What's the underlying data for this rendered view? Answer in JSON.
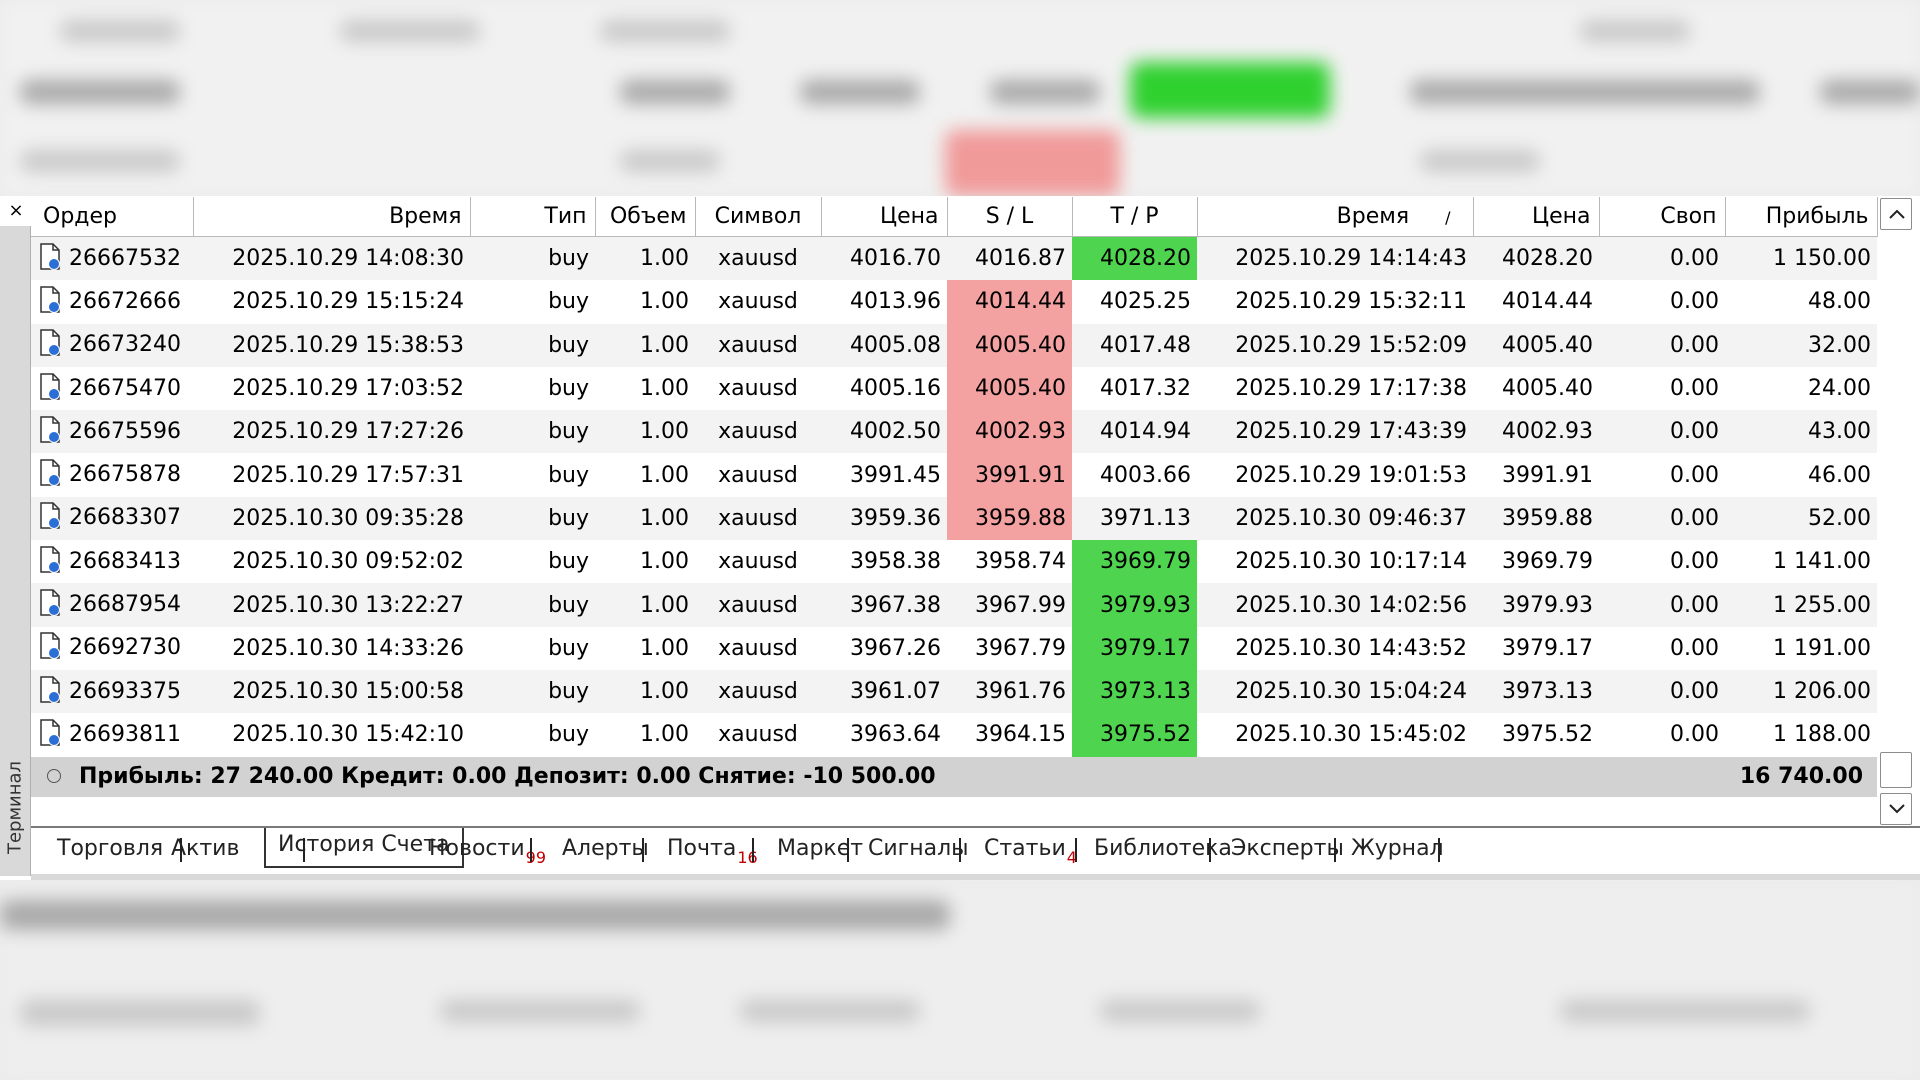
{
  "terminal": {
    "side_label": "Терминал",
    "close_glyph": "×"
  },
  "columns": [
    "Ордер",
    "Время",
    "Тип",
    "Объем",
    "Символ",
    "Цена",
    "S / L",
    "T / P",
    "Время",
    "Цена",
    "Своп",
    "Прибыль"
  ],
  "sort_indicator": "/",
  "rows": [
    {
      "order": "26667532",
      "open_time": "2025.10.29 14:08:30",
      "type": "buy",
      "volume": "1.00",
      "symbol": "xauusd",
      "open_price": "4016.70",
      "sl": "4016.87",
      "tp": "4028.20",
      "close_time": "2025.10.29 14:14:43",
      "close_price": "4028.20",
      "swap": "0.00",
      "profit": "1 150.00",
      "hit": "tp"
    },
    {
      "order": "26672666",
      "open_time": "2025.10.29 15:15:24",
      "type": "buy",
      "volume": "1.00",
      "symbol": "xauusd",
      "open_price": "4013.96",
      "sl": "4014.44",
      "tp": "4025.25",
      "close_time": "2025.10.29 15:32:11",
      "close_price": "4014.44",
      "swap": "0.00",
      "profit": "48.00",
      "hit": "sl"
    },
    {
      "order": "26673240",
      "open_time": "2025.10.29 15:38:53",
      "type": "buy",
      "volume": "1.00",
      "symbol": "xauusd",
      "open_price": "4005.08",
      "sl": "4005.40",
      "tp": "4017.48",
      "close_time": "2025.10.29 15:52:09",
      "close_price": "4005.40",
      "swap": "0.00",
      "profit": "32.00",
      "hit": "sl"
    },
    {
      "order": "26675470",
      "open_time": "2025.10.29 17:03:52",
      "type": "buy",
      "volume": "1.00",
      "symbol": "xauusd",
      "open_price": "4005.16",
      "sl": "4005.40",
      "tp": "4017.32",
      "close_time": "2025.10.29 17:17:38",
      "close_price": "4005.40",
      "swap": "0.00",
      "profit": "24.00",
      "hit": "sl"
    },
    {
      "order": "26675596",
      "open_time": "2025.10.29 17:27:26",
      "type": "buy",
      "volume": "1.00",
      "symbol": "xauusd",
      "open_price": "4002.50",
      "sl": "4002.93",
      "tp": "4014.94",
      "close_time": "2025.10.29 17:43:39",
      "close_price": "4002.93",
      "swap": "0.00",
      "profit": "43.00",
      "hit": "sl"
    },
    {
      "order": "26675878",
      "open_time": "2025.10.29 17:57:31",
      "type": "buy",
      "volume": "1.00",
      "symbol": "xauusd",
      "open_price": "3991.45",
      "sl": "3991.91",
      "tp": "4003.66",
      "close_time": "2025.10.29 19:01:53",
      "close_price": "3991.91",
      "swap": "0.00",
      "profit": "46.00",
      "hit": "sl"
    },
    {
      "order": "26683307",
      "open_time": "2025.10.30 09:35:28",
      "type": "buy",
      "volume": "1.00",
      "symbol": "xauusd",
      "open_price": "3959.36",
      "sl": "3959.88",
      "tp": "3971.13",
      "close_time": "2025.10.30 09:46:37",
      "close_price": "3959.88",
      "swap": "0.00",
      "profit": "52.00",
      "hit": "sl"
    },
    {
      "order": "26683413",
      "open_time": "2025.10.30 09:52:02",
      "type": "buy",
      "volume": "1.00",
      "symbol": "xauusd",
      "open_price": "3958.38",
      "sl": "3958.74",
      "tp": "3969.79",
      "close_time": "2025.10.30 10:17:14",
      "close_price": "3969.79",
      "swap": "0.00",
      "profit": "1 141.00",
      "hit": "tp"
    },
    {
      "order": "26687954",
      "open_time": "2025.10.30 13:22:27",
      "type": "buy",
      "volume": "1.00",
      "symbol": "xauusd",
      "open_price": "3967.38",
      "sl": "3967.99",
      "tp": "3979.93",
      "close_time": "2025.10.30 14:02:56",
      "close_price": "3979.93",
      "swap": "0.00",
      "profit": "1 255.00",
      "hit": "tp"
    },
    {
      "order": "26692730",
      "open_time": "2025.10.30 14:33:26",
      "type": "buy",
      "volume": "1.00",
      "symbol": "xauusd",
      "open_price": "3967.26",
      "sl": "3967.79",
      "tp": "3979.17",
      "close_time": "2025.10.30 14:43:52",
      "close_price": "3979.17",
      "swap": "0.00",
      "profit": "1 191.00",
      "hit": "tp"
    },
    {
      "order": "26693375",
      "open_time": "2025.10.30 15:00:58",
      "type": "buy",
      "volume": "1.00",
      "symbol": "xauusd",
      "open_price": "3961.07",
      "sl": "3961.76",
      "tp": "3973.13",
      "close_time": "2025.10.30 15:04:24",
      "close_price": "3973.13",
      "swap": "0.00",
      "profit": "1 206.00",
      "hit": "tp"
    },
    {
      "order": "26693811",
      "open_time": "2025.10.30 15:42:10",
      "type": "buy",
      "volume": "1.00",
      "symbol": "xauusd",
      "open_price": "3963.64",
      "sl": "3964.15",
      "tp": "3975.52",
      "close_time": "2025.10.30 15:45:02",
      "close_price": "3975.52",
      "swap": "0.00",
      "profit": "1 188.00",
      "hit": "tp"
    }
  ],
  "summary": {
    "text": "Прибыль: 27 240.00  Кредит: 0.00  Депозит: 0.00  Снятие: -10 500.00",
    "total": "16 740.00"
  },
  "tabs": [
    {
      "label": "Торговля",
      "badge": ""
    },
    {
      "label": "Актив",
      "badge": ""
    },
    {
      "label": "История Счета",
      "badge": "",
      "active": true
    },
    {
      "label": "Новости",
      "badge": "99"
    },
    {
      "label": "Алерты",
      "badge": ""
    },
    {
      "label": "Почта",
      "badge": "16"
    },
    {
      "label": "Маркет",
      "badge": ""
    },
    {
      "label": "Сигналы",
      "badge": ""
    },
    {
      "label": "Статьи",
      "badge": "4"
    },
    {
      "label": "Библиотека",
      "badge": ""
    },
    {
      "label": "Эксперты",
      "badge": ""
    },
    {
      "label": "Журнал",
      "badge": ""
    }
  ],
  "colors": {
    "sl_hit": "#f4a1a1",
    "tp_hit": "#4fd44f",
    "badge": "#c00000",
    "summary_bg": "#d2d2d2"
  },
  "icons": {
    "row_icon": "closed-order-doc-icon",
    "scroll_up": "chevron-up-icon",
    "scroll_down": "chevron-down-icon",
    "summary_bullet": "circle-bullet-icon"
  }
}
